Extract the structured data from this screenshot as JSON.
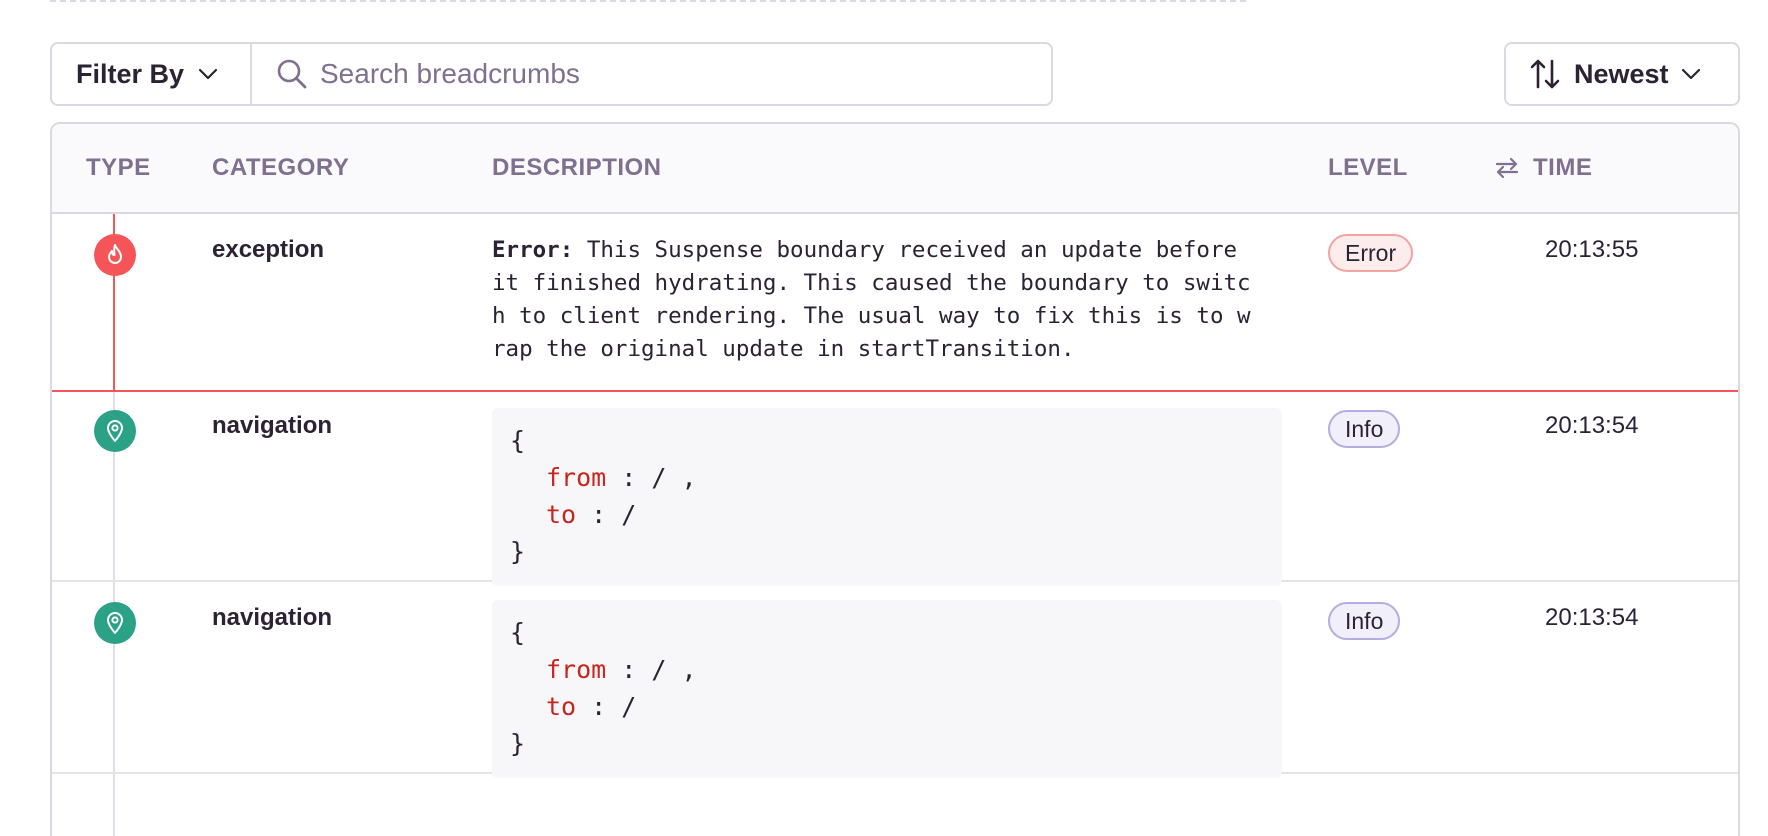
{
  "toolbar": {
    "filter_label": "Filter By",
    "search_placeholder": "Search breadcrumbs",
    "search_value": "",
    "sort_label": "Newest"
  },
  "table": {
    "headers": {
      "type": "TYPE",
      "category": "CATEGORY",
      "description": "DESCRIPTION",
      "level": "LEVEL",
      "time": "TIME"
    },
    "rows": [
      {
        "type_icon": "fire-icon",
        "category": "exception",
        "error_prefix": "Error:",
        "description": " This Suspense boundary received an update before it finished hydrating. This caused the boundary to switch to client rendering. The usual way to fix this is to wrap the original update in startTransition.",
        "level": "Error",
        "time": "20:13:55"
      },
      {
        "type_icon": "location-pin-icon",
        "category": "navigation",
        "code": {
          "open": "{",
          "from_key": "from",
          "from_value": " :  / ,",
          "to_key": "to",
          "to_value": " :  /",
          "close": "}"
        },
        "level": "Info",
        "time": "20:13:54"
      },
      {
        "type_icon": "location-pin-icon",
        "category": "navigation",
        "code": {
          "open": "{",
          "from_key": "from",
          "from_value": " :  / ,",
          "to_key": "to",
          "to_value": " :  /",
          "close": "}"
        },
        "level": "Info",
        "time": "20:13:54"
      }
    ]
  },
  "colors": {
    "error": "#f55459",
    "navigation": "#2ba185",
    "code_key": "#c8261d",
    "header_text": "#80708f",
    "border": "#dcd8e2"
  }
}
